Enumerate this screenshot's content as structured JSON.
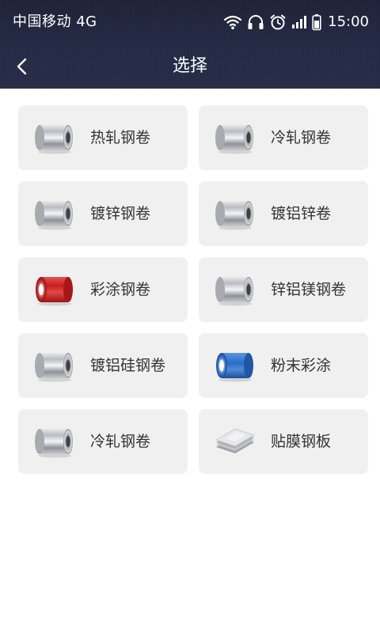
{
  "status_bar": {
    "carrier": "中国移动 4G",
    "time": "15:00",
    "icons": [
      "wifi-icon",
      "headphones-icon",
      "alarm-icon",
      "signal-icon",
      "battery-icon"
    ]
  },
  "nav": {
    "title": "选择",
    "back_icon": "chevron-left-icon"
  },
  "colors": {
    "header_bg": "#232842",
    "card_bg": "#f0f0f1",
    "text": "#333333"
  },
  "products": [
    {
      "label": "热轧钢卷",
      "image": "steel-coil-icon"
    },
    {
      "label": "冷轧钢卷",
      "image": "steel-coil-icon"
    },
    {
      "label": "镀锌钢卷",
      "image": "steel-coil-icon"
    },
    {
      "label": "镀铝锌卷",
      "image": "steel-coil-icon"
    },
    {
      "label": "彩涂钢卷",
      "image": "red-coil-icon"
    },
    {
      "label": "锌铝镁钢卷",
      "image": "steel-coil-icon"
    },
    {
      "label": "镀铝硅钢卷",
      "image": "steel-coil-icon"
    },
    {
      "label": "粉末彩涂",
      "image": "blue-coil-icon"
    },
    {
      "label": "冷轧钢卷",
      "image": "steel-coil-icon"
    },
    {
      "label": "贴膜钢板",
      "image": "steel-sheet-icon"
    }
  ]
}
